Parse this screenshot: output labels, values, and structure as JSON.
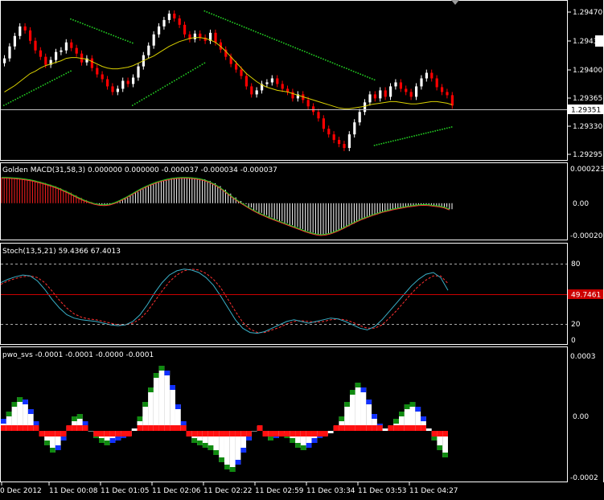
{
  "colors": {
    "background": "#000000",
    "frame": "#ffffff",
    "bull_candle": "#ffffff",
    "bear_candle": "#ff0000",
    "moving_average": "#d9d000",
    "sar_dots": "#22cc22",
    "macd_bull_hist": "#ffffff",
    "macd_bear_hist": "#ff2020",
    "macd_bull_line": "#22cc22",
    "macd_bear_line": "#ff3333",
    "stoch_main": "#3ab0c8",
    "stoch_signal": "#ff3030",
    "stoch_level_line": "#cc0000",
    "pwo_white": "#ffffff",
    "pwo_red": "#ff1010",
    "pwo_blue": "#1030ff",
    "pwo_green": "#108a10",
    "current_price_line": "#c0c0c0",
    "price_tag": "#ffffff"
  },
  "price_pane": {
    "current_price": "1.29351",
    "ticks": [
      "1.29470",
      "1.29435",
      "1.29400",
      "1.29365",
      "1.29330",
      "1.29295"
    ]
  },
  "macd_pane": {
    "title": "Golden MACD(31,58,3) 0.000000 0.000000 -0.000037 -0.000034 -0.000037",
    "ticks": [
      "0.000223",
      "0.00",
      "-0.00020"
    ]
  },
  "stoch_pane": {
    "title": "Stoch(13,5,21) 59.4366 67.4013",
    "ticks": [
      "80",
      "20",
      "0"
    ],
    "level_tag": "49.7461"
  },
  "pwo_pane": {
    "title": "pwo_svs -0.0001 -0.0001 -0.0000 -0.0001",
    "ticks": [
      "0.0003",
      "0.00",
      "-0.0002"
    ]
  },
  "time_axis": {
    "labels": [
      "0 Dec 2012",
      "11 Dec 00:08",
      "11 Dec 01:05",
      "11 Dec 02:06",
      "11 Dec 02:22",
      "11 Dec 02:59",
      "11 Dec 03:34",
      "11 Dec 03:53",
      "11 Dec 04:27"
    ]
  },
  "chart_data": [
    {
      "type": "candlestick",
      "title": "",
      "ylim": [
        1.29285,
        1.2948
      ],
      "close": [
        1.2941,
        1.29425,
        1.29438,
        1.2945,
        1.29445,
        1.29432,
        1.2942,
        1.29412,
        1.29402,
        1.29408,
        1.29418,
        1.2942,
        1.2943,
        1.29423,
        1.29416,
        1.29405,
        1.2941,
        1.29398,
        1.2939,
        1.29384,
        1.29375,
        1.29368,
        1.29372,
        1.29382,
        1.29378,
        1.29386,
        1.294,
        1.29414,
        1.29426,
        1.2944,
        1.2945,
        1.29458,
        1.29466,
        1.2946,
        1.29452,
        1.2944,
        1.29434,
        1.29441,
        1.29436,
        1.29432,
        1.29442,
        1.2943,
        1.29421,
        1.29412,
        1.29403,
        1.29396,
        1.29388,
        1.29375,
        1.29365,
        1.2937,
        1.29378,
        1.2938,
        1.29385,
        1.29378,
        1.29372,
        1.29368,
        1.2936,
        1.29365,
        1.29358,
        1.2935,
        1.29343,
        1.29335,
        1.29322,
        1.29315,
        1.29308,
        1.29303,
        1.29298,
        1.29315,
        1.2933,
        1.29343,
        1.29355,
        1.29365,
        1.2936,
        1.2937,
        1.29362,
        1.29375,
        1.2938,
        1.29372,
        1.29368,
        1.29362,
        1.29375,
        1.29385,
        1.29392,
        1.29385,
        1.29374,
        1.29368,
        1.29364,
        1.29351
      ]
    },
    {
      "type": "line",
      "title": "",
      "series": [
        {
          "name": "",
          "values": [
            1.29368,
            1.29372,
            1.29376,
            1.29381,
            1.29386,
            1.29391,
            1.29394,
            1.29398,
            1.29401,
            1.29403,
            1.29405,
            1.29407,
            1.2941,
            1.29411,
            1.29411,
            1.2941,
            1.29409,
            1.29406,
            1.29403,
            1.294,
            1.29398,
            1.29397,
            1.29397,
            1.29398,
            1.29399,
            1.29401,
            1.29404,
            1.29407,
            1.2941,
            1.29413,
            1.29417,
            1.29421,
            1.29425,
            1.29428,
            1.29431,
            1.29433,
            1.29435,
            1.29436,
            1.29436,
            1.29435,
            1.29433,
            1.2943,
            1.29425,
            1.29419,
            1.29412,
            1.29405,
            1.29398,
            1.29391,
            1.29386,
            1.29381,
            1.29377,
            1.29374,
            1.29372,
            1.2937,
            1.29369,
            1.29368,
            1.29366,
            1.29364,
            1.29362,
            1.2936,
            1.29358,
            1.29356,
            1.29354,
            1.29352,
            1.2935,
            1.29348,
            1.29347,
            1.29347,
            1.29348,
            1.29349,
            1.2935,
            1.29352,
            1.29353,
            1.29354,
            1.29355,
            1.29356,
            1.29356,
            1.29355,
            1.29354,
            1.29353,
            1.29353,
            1.29354,
            1.29355,
            1.29356,
            1.29356,
            1.29355,
            1.29354,
            1.29352
          ]
        }
      ]
    },
    {
      "type": "scatter",
      "title": "",
      "series": [
        {
          "name": "",
          "segments": [
            {
              "start": 0,
              "end": 13,
              "y0": 1.29352,
              "y1": 1.29395
            },
            {
              "start": 13,
              "end": 25,
              "y0": 1.2946,
              "y1": 1.2943
            },
            {
              "start": 25,
              "end": 39,
              "y0": 1.29352,
              "y1": 1.29405
            },
            {
              "start": 39,
              "end": 72,
              "y0": 1.2947,
              "y1": 1.29384
            },
            {
              "start": 72,
              "end": 87,
              "y0": 1.29302,
              "y1": 1.29325
            }
          ]
        }
      ]
    },
    {
      "type": "bar",
      "title": "",
      "ylim": [
        -0.00022,
        0.000223
      ],
      "series": [
        {
          "name": "",
          "values": [
            0.00016,
            0.00016,
            0.000158,
            0.000156,
            0.000152,
            0.000148,
            0.000142,
            0.000134,
            0.000126,
            0.000116,
            0.000106,
            9.4e-05,
            8e-05,
            6.6e-05,
            5e-05,
            3.4e-05,
            2e-05,
            8e-06,
            -2e-06,
            -8e-06,
            -1e-05,
            -6e-06,
            4e-06,
            1.8e-05,
            3.4e-05,
            5.2e-05,
            7e-05,
            8.8e-05,
            0.000104,
            0.000118,
            0.00013,
            0.00014,
            0.000148,
            0.000154,
            0.000158,
            0.00016,
            0.00016,
            0.000158,
            0.000154,
            0.000148,
            0.000138,
            0.000124,
            0.000106,
            8.4e-05,
            6e-05,
            3.6e-05,
            1.4e-05,
            -6e-06,
            -2.6e-05,
            -4.4e-05,
            -6e-05,
            -7.4e-05,
            -8.8e-05,
            -0.0001,
            -0.000112,
            -0.000124,
            -0.000136,
            -0.000148,
            -0.00016,
            -0.000172,
            -0.000182,
            -0.00019,
            -0.000195,
            -0.000192,
            -0.000184,
            -0.000172,
            -0.000158,
            -0.000142,
            -0.000126,
            -0.00011,
            -9.6e-05,
            -8.4e-05,
            -7.2e-05,
            -6.2e-05,
            -5.2e-05,
            -4.4e-05,
            -3.6e-05,
            -3e-05,
            -2.4e-05,
            -1.8e-05,
            -1.4e-05,
            -1e-05,
            -8e-06,
            -1e-05,
            -1.4e-05,
            -1.8e-05,
            -2.4e-05,
            -3.7e-05
          ]
        }
      ]
    },
    {
      "type": "line",
      "title": "",
      "ylim": [
        0,
        100
      ],
      "series": [
        {
          "name": "",
          "values": [
            68,
            72,
            75,
            77,
            76,
            70,
            60,
            48,
            38,
            30,
            26,
            24,
            23,
            22,
            20,
            18,
            17,
            18,
            22,
            30,
            42,
            56,
            68,
            77,
            82,
            84,
            83,
            80,
            74,
            65,
            52,
            38,
            24,
            14,
            9,
            8,
            10,
            14,
            18,
            22,
            24,
            22,
            20,
            22,
            24,
            26,
            25,
            22,
            18,
            14,
            12,
            16,
            24,
            34,
            44,
            54,
            64,
            72,
            78,
            80,
            74,
            59
          ]
        },
        {
          "name": "",
          "values": [
            66,
            70,
            73,
            75,
            76,
            74,
            68,
            58,
            47,
            38,
            31,
            27,
            25,
            24,
            22,
            20,
            18,
            18,
            20,
            25,
            34,
            46,
            58,
            69,
            77,
            82,
            84,
            83,
            79,
            72,
            62,
            48,
            34,
            21,
            13,
            9,
            9,
            12,
            15,
            19,
            22,
            23,
            22,
            21,
            22,
            24,
            25,
            24,
            21,
            17,
            14,
            14,
            18,
            26,
            35,
            45,
            55,
            64,
            71,
            76,
            76,
            67
          ]
        }
      ]
    },
    {
      "type": "bar",
      "title": "",
      "ylim": [
        -0.0002,
        0.0003
      ],
      "series": [
        {
          "name": "",
          "values": [
            5e-05,
            8e-05,
            0.00012,
            0.00014,
            0.00013,
            9e-05,
            4e-05,
            -2e-05,
            -6e-05,
            -9e-05,
            -8e-05,
            -4e-05,
            2e-05,
            6e-05,
            7e-05,
            4e-05,
            0.0,
            -3e-05,
            -5e-05,
            -6e-05,
            -5e-05,
            -4e-05,
            -3e-05,
            -2e-05,
            1e-05,
            6e-05,
            0.00012,
            0.00018,
            0.00024,
            0.00027,
            0.00025,
            0.00019,
            0.00011,
            4e-05,
            -2e-05,
            -5e-05,
            -6e-05,
            -7e-05,
            -8e-05,
            -0.0001,
            -0.00013,
            -0.00016,
            -0.00017,
            -0.00014,
            -9e-05,
            -4e-05,
            0.0,
            2e-05,
            -2e-05,
            -4e-05,
            -3e-05,
            -2e-05,
            -3e-05,
            -5e-05,
            -7e-05,
            -8e-05,
            -7e-05,
            -5e-05,
            -3e-05,
            -2e-05,
            -1e-05,
            2e-05,
            6e-05,
            0.00012,
            0.00017,
            0.0002,
            0.00018,
            0.00013,
            7e-05,
            3e-05,
            1e-05,
            2e-05,
            5e-05,
            8e-05,
            0.00011,
            0.00012,
            0.0001,
            6e-05,
            1e-05,
            -4e-05,
            -8e-05,
            -0.00011
          ]
        }
      ]
    }
  ]
}
